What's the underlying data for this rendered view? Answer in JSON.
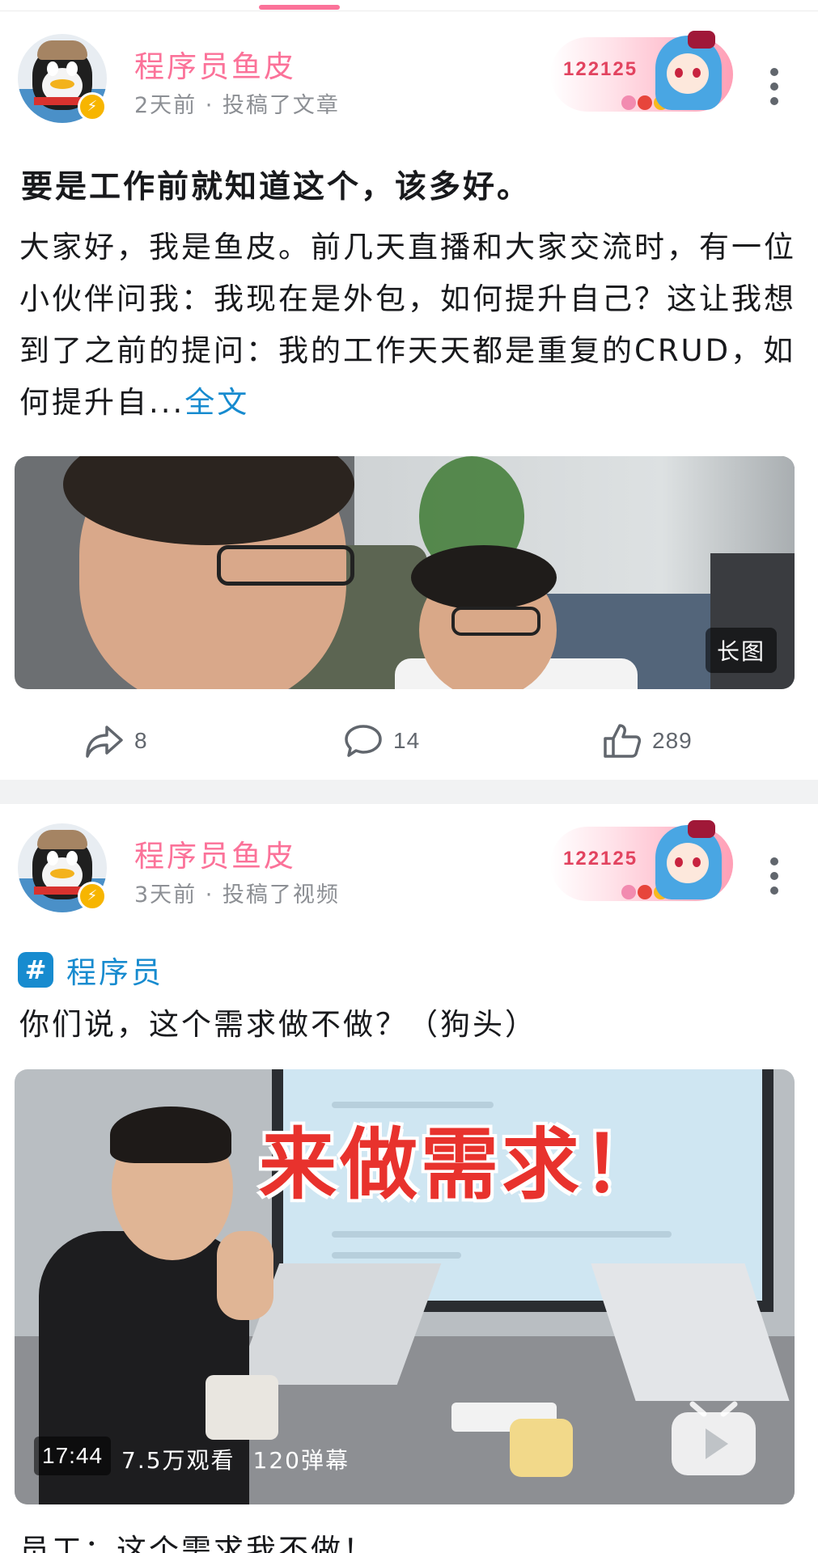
{
  "posts": [
    {
      "author": "程序员鱼皮",
      "meta": "2天前 · 投稿了文章",
      "fan_badge_number": "122125",
      "title": "要是工作前就知道这个，该多好。",
      "body": "大家好，我是鱼皮。前几天直播和大家交流时，有一位小伙伴问我：我现在是外包，如何提升自己？这让我想到了之前的提问：我的工作天天都是重复的CRUD，如何提升自...",
      "read_more": "全文",
      "image_tag": "长图",
      "shares": "8",
      "comments": "14",
      "likes": "289"
    },
    {
      "author": "程序员鱼皮",
      "meta": "3天前 · 投稿了视频",
      "fan_badge_number": "122125",
      "topic": "程序员",
      "title": "你们说，这个需求做不做？（狗头）",
      "overlay_text": "来做需求！",
      "duration": "17:44",
      "views": "7.5万观看",
      "danmaku": "120弹幕",
      "next_line": "员工：这个需求我不做！"
    }
  ],
  "icons": {
    "share": "share-icon",
    "comment": "comment-icon",
    "like": "thumbs-up-icon",
    "more": "more-vertical-icon",
    "play": "play-icon",
    "topic": "hashtag-icon",
    "badge": "lightning-icon"
  },
  "colors": {
    "accent": "#fb7299",
    "link": "#178bcf",
    "muted": "#8c8f94"
  }
}
